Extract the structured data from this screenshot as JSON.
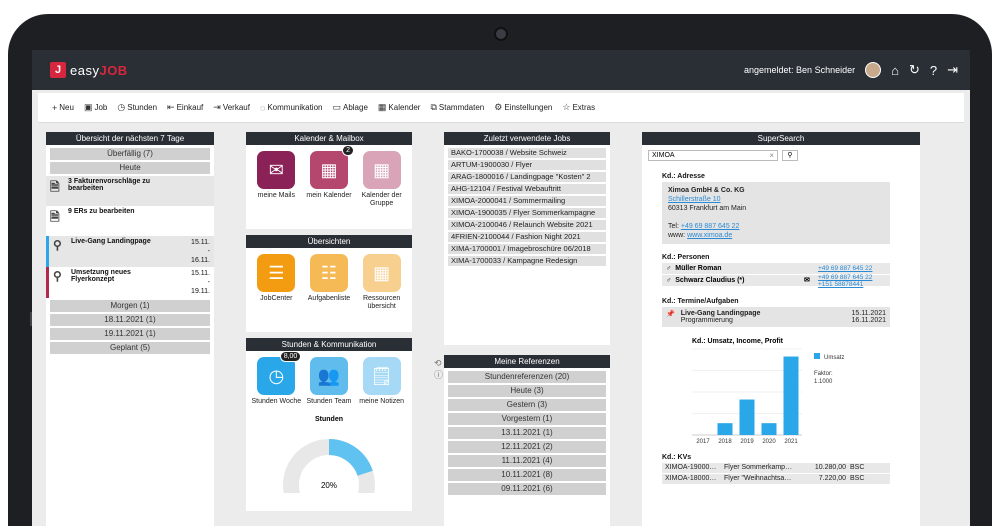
{
  "brand": {
    "easy": "easy",
    "job": "JOB",
    "logo_letter": "J"
  },
  "topbar": {
    "logged_in": "angemeldet: Ben Schneider"
  },
  "toolbar": {
    "items": [
      {
        "label": "Neu",
        "icon": "+"
      },
      {
        "label": "Job",
        "icon": "▣"
      },
      {
        "label": "Stunden",
        "icon": "◷"
      },
      {
        "label": "Einkauf",
        "icon": "⇤"
      },
      {
        "label": "Verkauf",
        "icon": "⇥"
      },
      {
        "label": "Kommunikation",
        "icon": "◌"
      },
      {
        "label": "Ablage",
        "icon": "▭"
      },
      {
        "label": "Kalender",
        "icon": "▦"
      },
      {
        "label": "Stammdaten",
        "icon": "⧉"
      },
      {
        "label": "Einstellungen",
        "icon": "⚙"
      },
      {
        "label": "Extras",
        "icon": "☆"
      }
    ]
  },
  "overview": {
    "title": "Übersicht der nächsten 7 Tage",
    "overdue": "Überfällig (7)",
    "today": "Heute",
    "tasks": [
      {
        "text": "3 Fakturenvorschläge zu bearbeiten",
        "date": "",
        "date2": ""
      },
      {
        "text": "9 ERs zu bearbeiten",
        "date": "",
        "date2": ""
      },
      {
        "text": "Live-Gang Landingpage",
        "date": "15.11.",
        "date2": "16.11."
      },
      {
        "text": "Umsetzung neues Flyerkonzept",
        "date": "15.11.",
        "date2": "19.11."
      }
    ],
    "groups": [
      "Morgen (1)",
      "18.11.2021 (1)",
      "19.11.2021 (1)",
      "Geplant (5)"
    ]
  },
  "calendar": {
    "title": "Kalender & Mailbox",
    "tiles": [
      {
        "label": "meine Mails",
        "color": "#8b2257"
      },
      {
        "label": "mein Kalender",
        "color": "#b5476f",
        "badge": "2"
      },
      {
        "label": "Kalender der Gruppe",
        "color": "#d9a4b8"
      }
    ]
  },
  "overviews": {
    "title": "Übersichten",
    "tiles": [
      {
        "label": "JobCenter",
        "color": "#f39c12"
      },
      {
        "label": "Aufgabenliste",
        "color": "#f5b955"
      },
      {
        "label": "Ressourcen übersicht",
        "color": "#f7cf8e"
      }
    ]
  },
  "hours": {
    "title": "Stunden & Kommunikation",
    "tiles": [
      {
        "label": "Stunden Woche",
        "color": "#2aa7e8",
        "badge": "8,00"
      },
      {
        "label": "Stunden Team",
        "color": "#5fbcec"
      },
      {
        "label": "meine Notizen",
        "color": "#a6d9f5"
      }
    ],
    "donut_title": "Stunden",
    "donut_value": "20%",
    "donut_fraction": 0.2
  },
  "recent_jobs": {
    "title": "Zuletzt verwendete Jobs",
    "items": [
      "BAKO-1700038 / Website Schweiz",
      "ARTUM-1900030 / Flyer",
      "ARAG-1800016 / Landingpage \"Kosten\" 2",
      "AHG-12104 / Festival Webauftritt",
      "XIMOA-2000041 / Sommermailing",
      "XIMOA-1900035 / Flyer Sommerkampagne",
      "XIMOA-2100046 / Relaunch Website 2021",
      "4FRIEN-2100044 / Fashion Night 2021",
      "XIMA-1700001 / Imagebroschüre 06/2018",
      "XIMA-1700033 / Kampagne Redesign"
    ]
  },
  "references": {
    "title": "Meine Referenzen",
    "items": [
      "Stundenreferenzen (20)",
      "Heute (3)",
      "Gestern (3)",
      "Vorgestern (1)",
      "13.11.2021 (1)",
      "12.11.2021 (2)",
      "11.11.2021 (4)",
      "10.11.2021 (8)",
      "09.11.2021 (6)"
    ]
  },
  "supersearch": {
    "title": "SuperSearch",
    "query": "XIMOA",
    "addr_title": "Kd.: Adresse",
    "company": "Ximoa GmbH & Co. KG",
    "street": "Schillerstraße 10",
    "city": "60313 Frankfurt am Main",
    "tel_label": "Tel:",
    "tel": "+49 69 887 645 22",
    "www_label": "www:",
    "www": "www.ximoa.de",
    "persons_title": "Kd.: Personen",
    "persons": [
      {
        "name": "Müller Roman",
        "phone": "+49 69 887 645 22",
        "phone2": ""
      },
      {
        "name": "Schwarz Claudius (*)",
        "phone": "+49 69 887 645 22",
        "phone2": "+151 58878441"
      }
    ],
    "tasks_title": "Kd.: Termine/Aufgaben",
    "task_name": "Live-Gang Landingpage",
    "task_sub": "Programmierung",
    "task_d1": "15.11.2021",
    "task_d2": "16.11.2021",
    "kv_title": "Kd.: KVs",
    "kvs": [
      {
        "id": "XIMOA-19000…",
        "name": "Flyer Sommerkamp…",
        "amount": "10.280,00",
        "cur": "BSC"
      },
      {
        "id": "XIMOA-18000…",
        "name": "Flyer \"Weihnachtsa…",
        "amount": "7.220,00",
        "cur": "BSC"
      }
    ]
  },
  "chart_data": {
    "type": "bar",
    "title": "Kd.: Umsatz, Income, Profit",
    "categories": [
      "2017",
      "2018",
      "2019",
      "2020",
      "2021"
    ],
    "series": [
      {
        "name": "Umsatz",
        "values": [
          0,
          1.1,
          3.3,
          1.1,
          7.3
        ],
        "color": "#2aa7e8"
      }
    ],
    "ylim": [
      0,
      8
    ],
    "factor_label": "Faktor:",
    "factor_value": "1.1000"
  }
}
